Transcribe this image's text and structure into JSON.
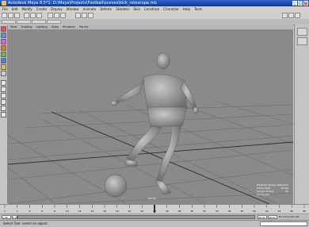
{
  "window": {
    "title": "Autodesk Maya 8.5*1: D:\\Maya\\Projects\\Football\\scenes\\kick_rotoscope.mb",
    "minimize": "_",
    "maximize": "□",
    "close": "×"
  },
  "menu": [
    "File",
    "Edit",
    "Modify",
    "Create",
    "Display",
    "Window",
    "Animate",
    "Deform",
    "Skeleton",
    "Skin",
    "Constrain",
    "Character",
    "Help",
    "Tools"
  ],
  "panel_menu": [
    "View",
    "Shading",
    "Lighting",
    "Show",
    "Renderer",
    "Panels"
  ],
  "viewport": {
    "camera_label": "persp",
    "hud": [
      {
        "label": "Playback Speed",
        "value": "Real-time"
      },
      {
        "label": "Frame Rate",
        "value": "24 fps"
      },
      {
        "label": "Current Frame",
        "value": "24"
      },
      {
        "label": "All Frames",
        "value": ""
      }
    ]
  },
  "timeline": {
    "ticks": [
      "1",
      "2",
      "4",
      "6",
      "8",
      "10",
      "12",
      "14",
      "16",
      "18",
      "20",
      "22",
      "24",
      "26",
      "28",
      "30",
      "32",
      "34",
      "36",
      "38",
      "40",
      "42",
      "44",
      "46",
      "48"
    ],
    "current_frame": "24"
  },
  "range": {
    "start": "1.00",
    "start_inner": "1.00",
    "end_inner": "48.00",
    "end": "48.00",
    "character_set": "No Character Set"
  },
  "command_line": {
    "help_text": "Select Tool: select an object",
    "mel_label": "MEL"
  },
  "colors": {
    "viewport_bg": "#8a8a8a",
    "grid": "#6e6e6e",
    "axis": "#2e2e2e",
    "model": "#a9a9a9",
    "titlebar": "#2f64c8"
  },
  "icons": [
    "select-tool-icon",
    "lasso-icon",
    "paint-icon",
    "move-icon",
    "rotate-icon",
    "scale-icon",
    "manipulator-icon",
    "last-tool-icon",
    "layout-single-icon",
    "layout-four-icon",
    "layout-persp-icon",
    "layout-outliner-icon",
    "layout-graph-icon",
    "layout-hypershade-icon"
  ]
}
